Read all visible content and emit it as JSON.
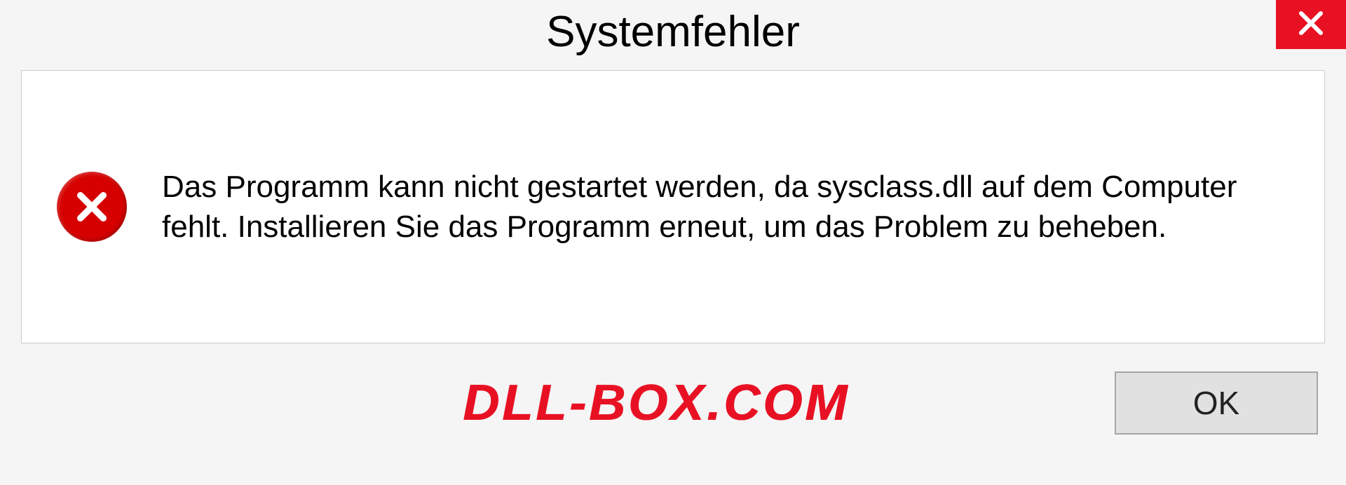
{
  "dialog": {
    "title": "Systemfehler",
    "message": "Das Programm kann nicht gestartet werden, da sysclass.dll auf dem Computer fehlt. Installieren Sie das Programm erneut, um das Problem zu beheben.",
    "ok_label": "OK"
  },
  "watermark": "DLL-BOX.COM"
}
